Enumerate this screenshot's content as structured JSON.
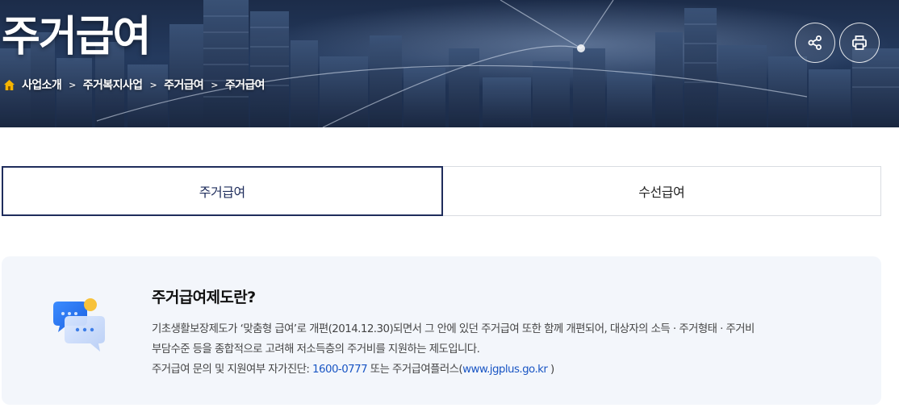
{
  "hero": {
    "title": "주거급여",
    "breadcrumb": [
      "사업소개",
      "주거복지사업",
      "주거급여",
      "주거급여"
    ],
    "share_icon": "share-icon",
    "print_icon": "print-icon"
  },
  "tabs": [
    {
      "label": "주거급여",
      "active": true
    },
    {
      "label": "수선급여",
      "active": false
    }
  ],
  "info": {
    "title": "주거급여제도란?",
    "line1": "기초생활보장제도가 ‘맞춤형 급여’로 개편(2014.12.30)되면서 그 안에 있던 주거급여 또한 함께 개편되어, 대상자의 소득 · 주거형태 · 주거비",
    "line2": "부담수준 등을 종합적으로 고려해 저소득층의 주거비를 지원하는 제도입니다.",
    "line3_prefix": "주거급여 문의 및 지원여부 자가진단: ",
    "phone": "1600-0777",
    "line3_mid": " 또는 주거급여플러스(",
    "site": "www.jgplus.go.kr",
    "line3_suffix": " )",
    "icon": "chat-bubbles-icon"
  },
  "colors": {
    "tab_active_border": "#1f2d5c",
    "info_bg": "#f3f6fb",
    "link": "#1a56c4",
    "home_icon": "#f5b400"
  }
}
